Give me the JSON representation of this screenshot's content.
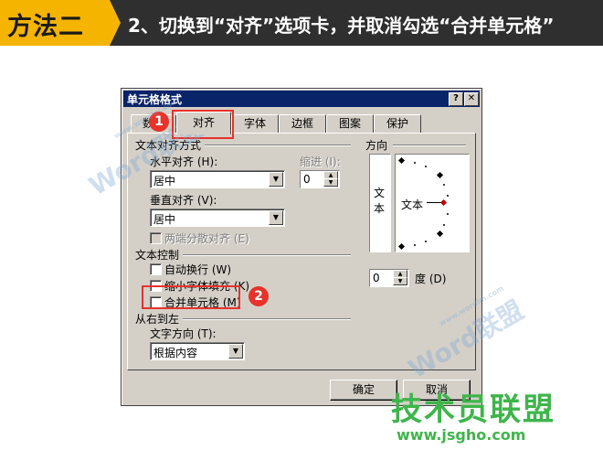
{
  "banner": {
    "badge": "方法二",
    "text": "2、切换到“对齐”选项卡，并取消勾选“合并单元格”"
  },
  "dialog": {
    "title": "单元格格式",
    "help_btn": "?",
    "close_btn": "✕",
    "tabs": [
      "数字",
      "对齐",
      "字体",
      "边框",
      "图案",
      "保护"
    ],
    "active_tab": "对齐",
    "text_align": {
      "group_label": "文本对齐方式",
      "horizontal_label": "水平对齐 (H):",
      "horizontal_value": "居中",
      "indent_label": "缩进 (I):",
      "indent_value": "0",
      "vertical_label": "垂直对齐 (V):",
      "vertical_value": "居中",
      "distributed_label": "两端分散对齐 (E)"
    },
    "text_control": {
      "group_label": "文本控制",
      "wrap_label": "自动换行 (W)",
      "shrink_label": "缩小字体填充 (K)",
      "merge_label": "合并单元格 (M)"
    },
    "rtl": {
      "group_label": "从右到左",
      "direction_label": "文字方向 (T):",
      "direction_value": "根据内容"
    },
    "orientation": {
      "group_label": "方向",
      "vertical_text": "文本",
      "horizontal_text": "文本",
      "degree_value": "0",
      "degree_label": "度 (D)"
    },
    "ok_label": "确定",
    "cancel_label": "取消"
  },
  "annotations": {
    "marker1": "1",
    "marker2": "2",
    "accent_color": "#e8322a"
  },
  "watermarks": {
    "word_lianmeng": "Word联盟",
    "site_url_small": "www.wordlm.com",
    "logo": "技术员联盟",
    "logo_url": "www.jsgho.com"
  }
}
